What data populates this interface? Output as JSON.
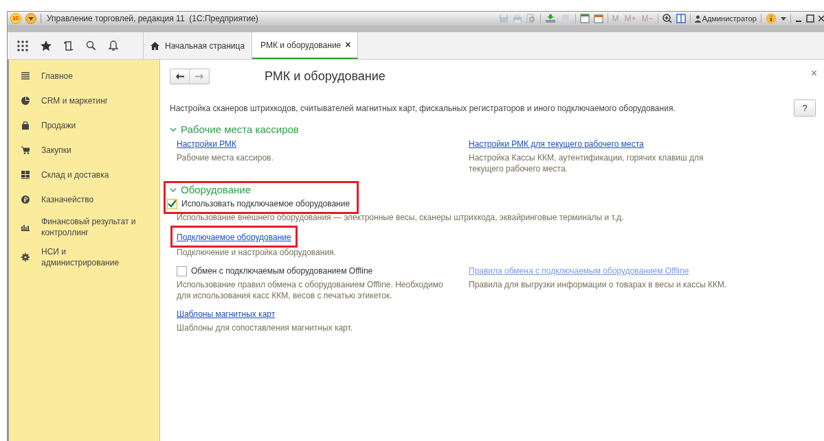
{
  "window": {
    "title": "Управление торговлей, редакция 11  (1С:Предприятие)",
    "logo": "1С",
    "memory_buttons": [
      "M",
      "M+",
      "M−"
    ],
    "user": "Администратор"
  },
  "tabs": [
    {
      "label": "Начальная страница",
      "kind": "home",
      "selected": false
    },
    {
      "label": "РМК и оборудование",
      "kind": "closable",
      "selected": true,
      "close": "×"
    }
  ],
  "sidebar": {
    "items": [
      {
        "label": "Главное",
        "kind": "lines"
      },
      {
        "label": "CRM и маркетинг",
        "kind": "pie"
      },
      {
        "label": "Продажи",
        "kind": "bag"
      },
      {
        "label": "Закупки",
        "kind": "cart"
      },
      {
        "label": "Склад и доставка",
        "kind": "grid"
      },
      {
        "label": "Казначейство",
        "kind": "coin"
      },
      {
        "label": "Финансовый результат и контроллинг",
        "kind": "bars"
      },
      {
        "label": "НСИ и администрирование",
        "kind": "gear"
      }
    ]
  },
  "page": {
    "title": "РМК и оборудование",
    "close": "×",
    "help": "?",
    "description": "Настройка сканеров штрихкодов, считывателей магнитных карт, фискальных регистраторов и иного подключаемого оборудования.",
    "sections": [
      {
        "title": "Рабочие места кассиров",
        "expanded": true,
        "highlighted": false,
        "rows": [
          {
            "left": {
              "kind": "link",
              "label": "Настройки РМК",
              "disabled": false,
              "highlighted": false,
              "description": "Рабочие места кассиров."
            },
            "right": {
              "kind": "link",
              "label": "Настройки РМК для текущего рабочего места",
              "disabled": false,
              "highlighted": false,
              "description": "Настройка Кассы ККМ, аутентификации, горячих клавиш для текущего рабочего места."
            }
          }
        ]
      },
      {
        "title": "Оборудование",
        "expanded": true,
        "highlighted": true,
        "rows": [
          {
            "left": {
              "kind": "checkbox",
              "label": "Использовать подключаемое оборудование",
              "checked": true,
              "highlighted": false,
              "description": "Использование внешнего оборудования — электронные весы, сканеры штрихкода, эквайринговые терминалы и т.д."
            },
            "wide": true
          },
          {
            "left": {
              "kind": "link",
              "label": "Подключаемое оборудование",
              "disabled": false,
              "highlighted": true,
              "description": "Подключение и настройка оборудования."
            }
          },
          {
            "left": {
              "kind": "checkbox",
              "label": "Обмен с подключаемым оборудованием Offline",
              "checked": false,
              "highlighted": false,
              "description": "Использование правил обмена с оборудованием Offline. Необходимо для использования касс ККМ, весов с печатью этикеток."
            },
            "right": {
              "kind": "link",
              "label": "Правила обмена с подключаемым оборудованием Offline",
              "disabled": true,
              "highlighted": false,
              "description": "Правила для выгрузки информации о товарах в весы и кассы ККМ."
            }
          },
          {
            "left": {
              "kind": "link",
              "label": "Шаблоны магнитных карт",
              "disabled": false,
              "highlighted": false,
              "description": "Шаблоны для сопоставления магнитных карт."
            }
          }
        ]
      }
    ]
  }
}
